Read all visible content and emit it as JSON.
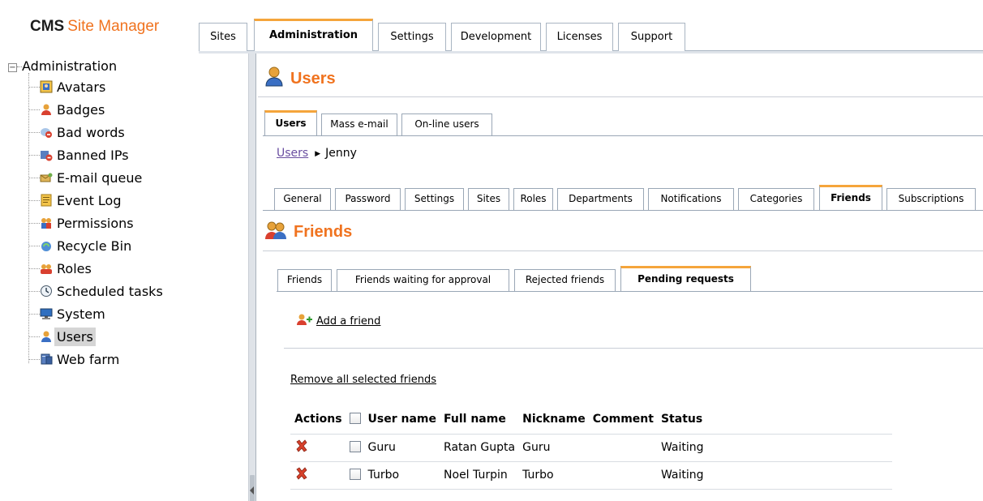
{
  "app": {
    "brand_cms": "CMS",
    "brand_rest": "Site Manager"
  },
  "top_tabs": [
    {
      "label": "Sites",
      "active": false
    },
    {
      "label": "Administration",
      "active": true
    },
    {
      "label": "Settings",
      "active": false
    },
    {
      "label": "Development",
      "active": false
    },
    {
      "label": "Licenses",
      "active": false
    },
    {
      "label": "Support",
      "active": false
    }
  ],
  "tree": {
    "root_label": "Administration",
    "items": [
      {
        "label": "Avatars",
        "icon": "avatar-icon"
      },
      {
        "label": "Badges",
        "icon": "badge-icon"
      },
      {
        "label": "Bad words",
        "icon": "bad-words-icon"
      },
      {
        "label": "Banned IPs",
        "icon": "banned-ip-icon"
      },
      {
        "label": "E-mail queue",
        "icon": "email-queue-icon"
      },
      {
        "label": "Event Log",
        "icon": "event-log-icon"
      },
      {
        "label": "Permissions",
        "icon": "permissions-icon"
      },
      {
        "label": "Recycle Bin",
        "icon": "recycle-bin-icon"
      },
      {
        "label": "Roles",
        "icon": "roles-icon"
      },
      {
        "label": "Scheduled tasks",
        "icon": "clock-icon"
      },
      {
        "label": "System",
        "icon": "monitor-icon"
      },
      {
        "label": "Users",
        "icon": "user-icon",
        "selected": true
      },
      {
        "label": "Web farm",
        "icon": "server-icon"
      }
    ]
  },
  "page": {
    "title": "Users",
    "sub_tabs": [
      "Users",
      "Mass e-mail",
      "On-line users"
    ],
    "breadcrumb": {
      "link": "Users",
      "current": "Jenny"
    },
    "user_tabs": [
      "General",
      "Password",
      "Settings",
      "Sites",
      "Roles",
      "Departments",
      "Notifications",
      "Categories",
      "Friends",
      "Subscriptions"
    ],
    "section_title": "Friends",
    "friend_tabs": [
      "Friends",
      "Friends waiting for approval",
      "Rejected friends",
      "Pending requests"
    ],
    "add_friend": "Add a friend",
    "remove_selected": "Remove all selected friends"
  },
  "table": {
    "columns": [
      "Actions",
      "",
      "User name",
      "Full name",
      "Nickname",
      "Comment",
      "Status"
    ],
    "rows": [
      {
        "user_name": "Guru",
        "full_name": "Ratan Gupta",
        "nickname": "Guru",
        "comment": "",
        "status": "Waiting"
      },
      {
        "user_name": "Turbo",
        "full_name": "Noel Turpin",
        "nickname": "Turbo",
        "comment": "",
        "status": "Waiting"
      }
    ]
  },
  "colors": {
    "accent_orange": "#f0731f",
    "tab_highlight": "#f5a53b",
    "link_purple": "#6a4ea0"
  }
}
